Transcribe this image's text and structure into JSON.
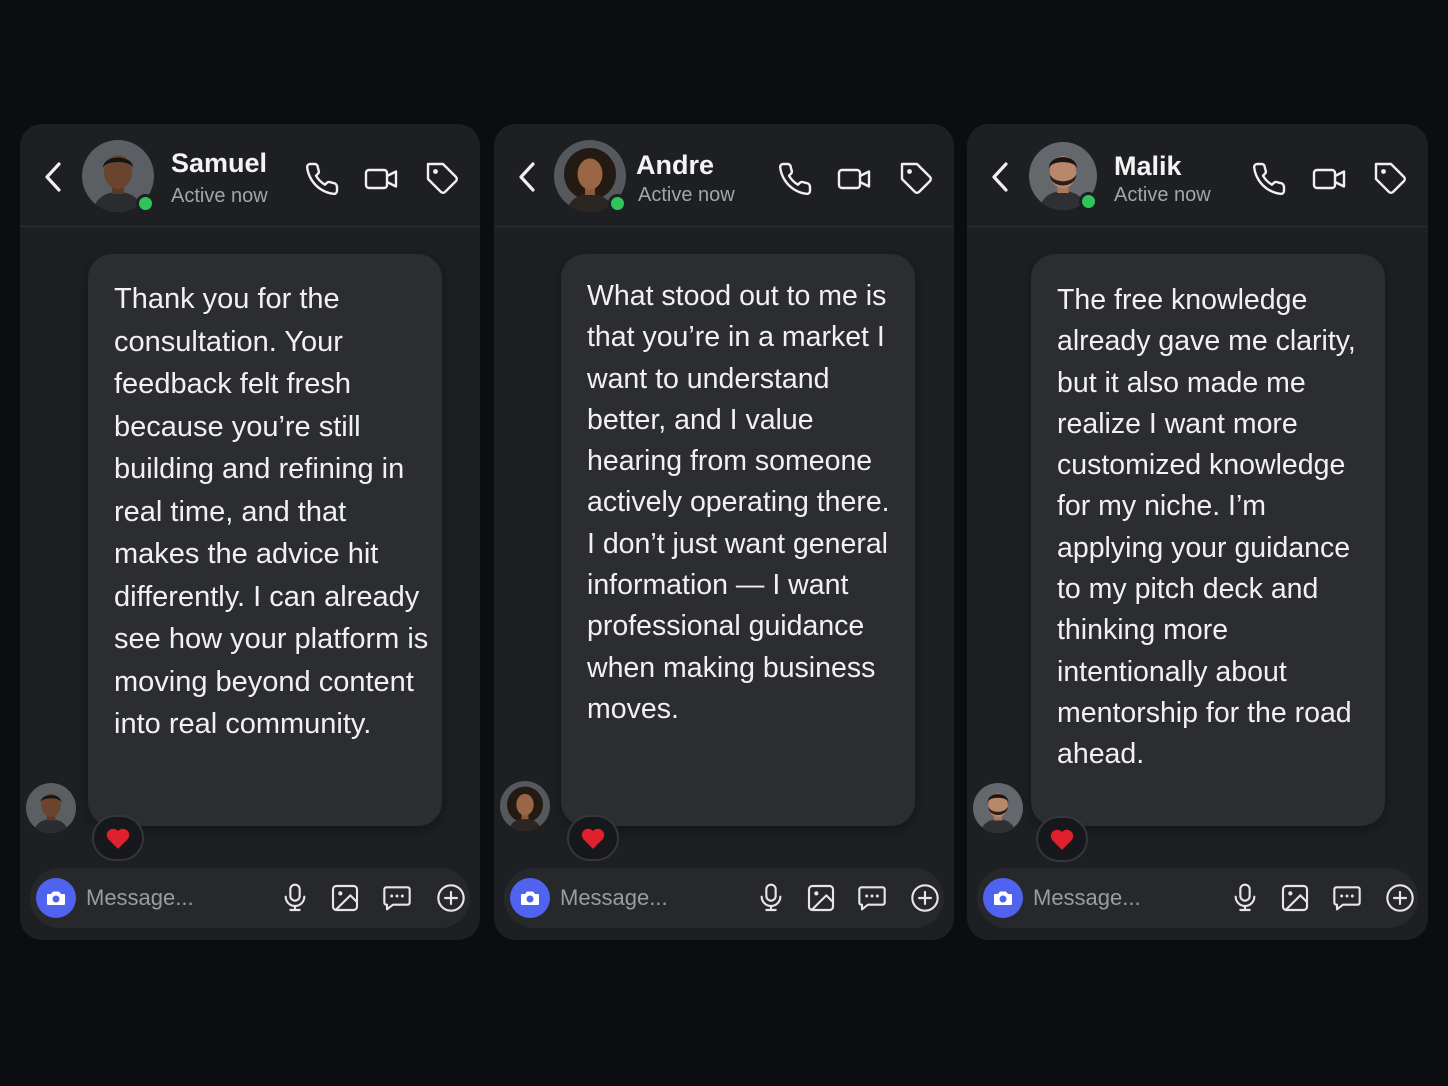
{
  "colors": {
    "page_background": "#0b0d11",
    "panel_background": "#1d1f23",
    "bubble_background": "#2b2d31",
    "online_indicator": "#31c45a",
    "camera_button": "#4f63ee",
    "reaction_heart": "#e0202d"
  },
  "icons": {
    "back": "chevron-left-icon",
    "call": "phone-icon",
    "video": "video-camera-icon",
    "tag": "tag-icon",
    "camera": "camera-icon",
    "mic": "microphone-icon",
    "gallery": "image-icon",
    "sticker": "chat-bubble-dots-icon",
    "add": "plus-circle-icon",
    "reaction": "heart-icon"
  },
  "chats": [
    {
      "contact": {
        "name": "Samuel",
        "status": "Active now"
      },
      "message": "Thank you for the consultation. Your feedback felt fresh because you’re still building and refining in real time, and that makes the advice hit differently. I can already see how your platform is moving beyond content into real community.",
      "reaction": "❤️",
      "composer": {
        "placeholder": "Message..."
      }
    },
    {
      "contact": {
        "name": "Andre",
        "status": "Active now"
      },
      "message": "What stood out to me is that you’re in a market I want to understand better, and I value hearing from someone actively operating there. I don’t just want general information — I want professional guidance when making business moves.",
      "reaction": "❤️",
      "composer": {
        "placeholder": "Message..."
      }
    },
    {
      "contact": {
        "name": "Malik",
        "status": "Active now"
      },
      "message": "The free knowledge already gave me clarity, but it also made me realize I want more customized knowledge for my niche. I’m applying your guidance to my pitch deck and thinking more intentionally about mentorship for the road ahead.",
      "reaction": "❤️",
      "composer": {
        "placeholder": "Message..."
      }
    }
  ]
}
